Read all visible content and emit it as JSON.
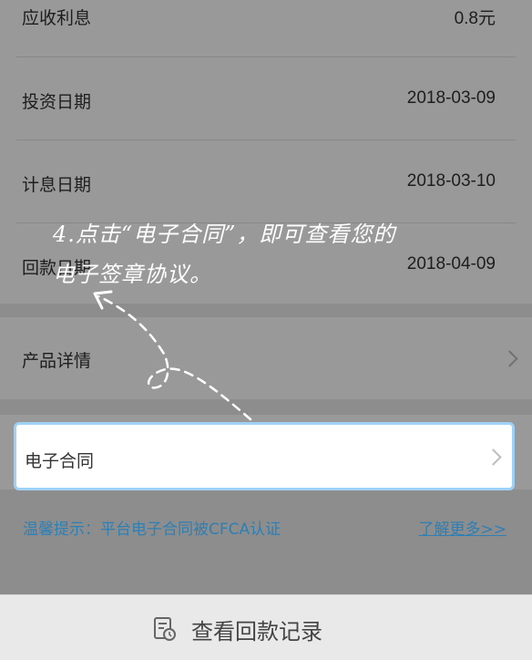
{
  "details": {
    "interest_label": "应收利息",
    "interest_value": "0.8元",
    "invest_date_label": "投资日期",
    "invest_date_value": "2018-03-09",
    "accrual_date_label": "计息日期",
    "accrual_date_value": "2018-03-10",
    "repay_date_label": "回款日期",
    "repay_date_value": "2018-04-09"
  },
  "product_detail": {
    "label": "产品详情",
    "icon": "chevron-right-icon"
  },
  "contract": {
    "label": "电子合同",
    "icon": "chevron-right-icon",
    "highlight_color": "#9fd0f6"
  },
  "notice": {
    "text": "温馨提示：平台电子合同被CFCA认证",
    "link": "了解更多>>",
    "color": "#2e7fb4"
  },
  "bottom": {
    "label": "查看回款记录",
    "icon": "repayment-record-icon"
  },
  "hint": {
    "line1": "4.点击“电子合同”，即可查看您的",
    "line2": "电子签章协议。"
  }
}
